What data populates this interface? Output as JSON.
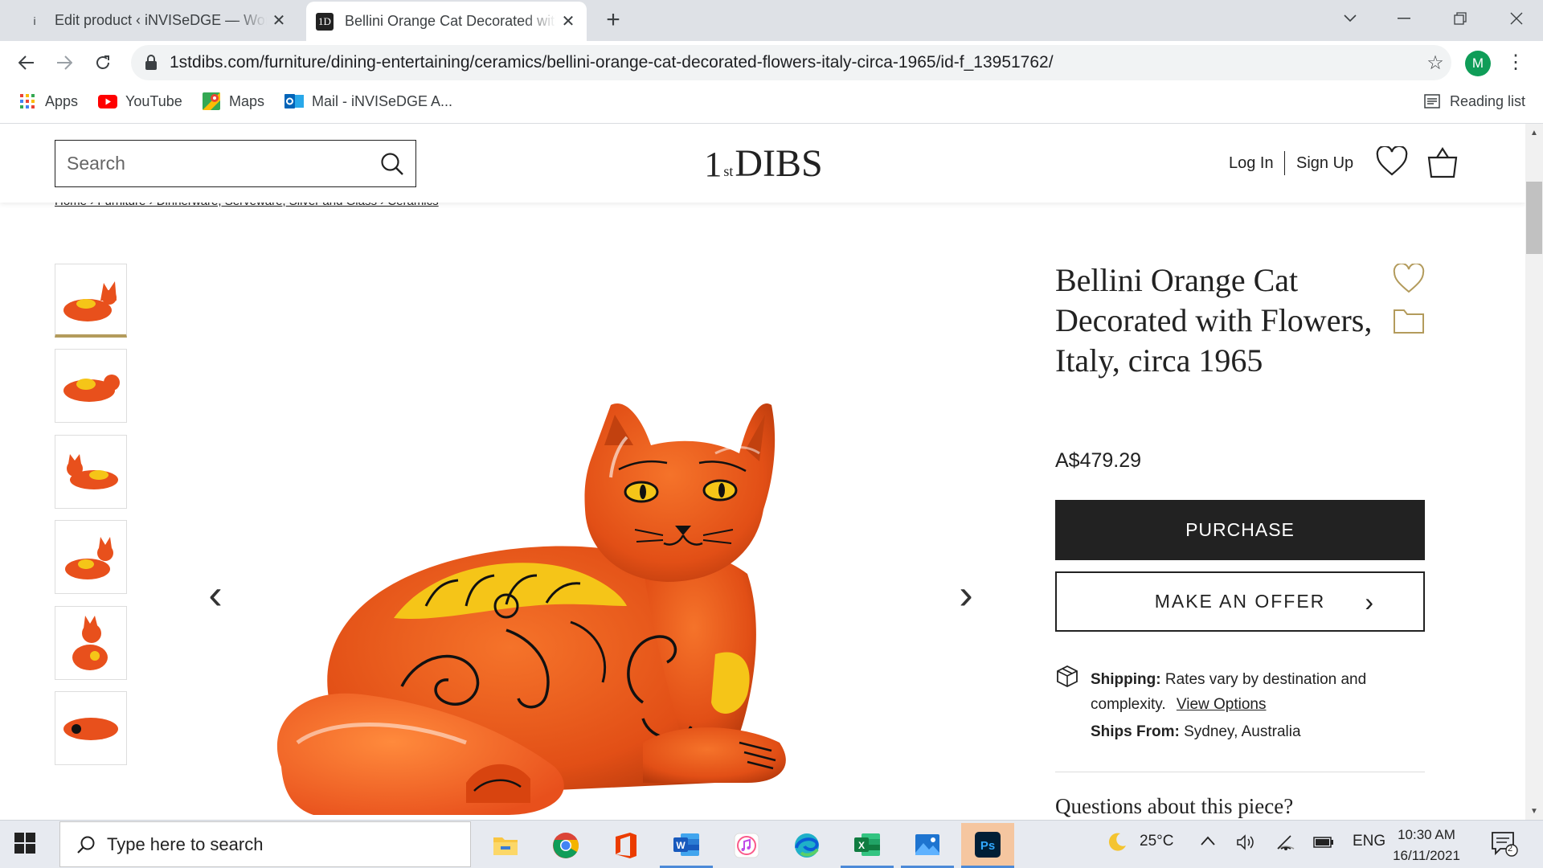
{
  "browser": {
    "tabs": [
      {
        "icon": "i",
        "title": "Edit product ‹ iNVISeDGE — WordPress",
        "active": false
      },
      {
        "icon": "1D",
        "title": "Bellini Orange Cat Decorated with Flowers",
        "active": true
      }
    ],
    "url": "1stdibs.com/furniture/dining-entertaining/ceramics/bellini-orange-cat-decorated-flowers-italy-circa-1965/id-f_13951762/",
    "profile_initial": "M",
    "bookmarks": [
      {
        "label": "Apps",
        "icon": "apps-grid-icon"
      },
      {
        "label": "YouTube",
        "icon": "youtube-icon"
      },
      {
        "label": "Maps",
        "icon": "maps-icon"
      },
      {
        "label": "Mail - iNVISeDGE A...",
        "icon": "outlook-icon"
      }
    ],
    "reading_list": "Reading list"
  },
  "site": {
    "search_placeholder": "Search",
    "logo": {
      "sup_top": "1",
      "sup_bottom": "st",
      "text": "DIBS"
    },
    "login": "Log In",
    "signup": "Sign Up",
    "breadcrumb": "Home  ›  Furniture  ›  Dinnerware, Serveware, Silver and Glass  ›  Ceramics"
  },
  "product": {
    "title": "Bellini Orange Cat Decorated with Flowers, Italy, circa 1965",
    "price": "A$479.29",
    "purchase_label": "PURCHASE",
    "offer_label": "MAKE AN OFFER",
    "shipping_label": "Shipping:",
    "shipping_text": "Rates vary by destination and complexity.",
    "view_options": "View Options",
    "ships_from_label": "Ships From:",
    "ships_from": "Sydney, Australia",
    "questions": "Questions about this piece?",
    "thumbnail_count": 6,
    "selected_thumbnail": 1
  },
  "taskbar": {
    "search_placeholder": "Type here to search",
    "apps": [
      "file-explorer-icon",
      "chrome-icon",
      "office-icon",
      "word-icon",
      "itunes-icon",
      "edge-icon",
      "excel-icon",
      "photos-icon",
      "photoshop-icon"
    ],
    "weather": "25°C",
    "language": "ENG",
    "time": "10:30 AM",
    "date": "16/11/2021",
    "notifications": "2"
  },
  "colors": {
    "accent_gold": "#b39b5c",
    "cat_orange": "#e8501c",
    "flower_yellow": "#f5c518"
  }
}
